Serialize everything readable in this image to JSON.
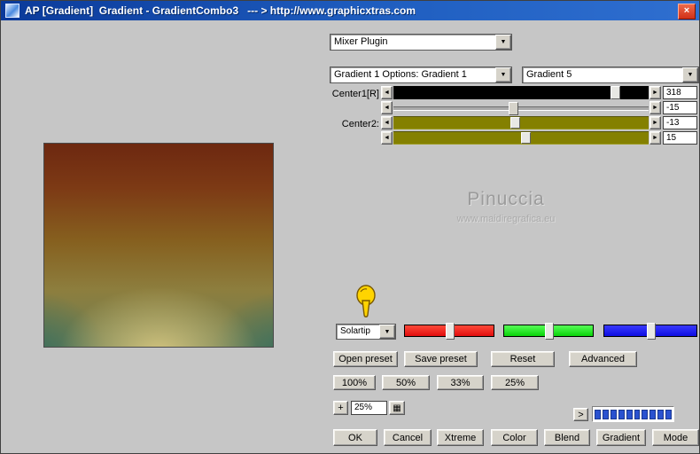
{
  "window": {
    "title": "AP [Gradient]  Gradient - GradientCombo3   --- > http://www.graphicxtras.com"
  },
  "icons": {
    "close": "×",
    "dropdown_arrow": "▼",
    "left_arrow": "◄",
    "right_arrow": "►",
    "grid": "▦"
  },
  "combos": {
    "plugin": "Mixer Plugin",
    "gradient_options": "Gradient 1 Options: Gradient 1",
    "gradient_preset": "Gradient 5",
    "tip": "Solartip",
    "zoom_value": "25%"
  },
  "sliders": {
    "center1_label": "Center1[R]",
    "center2_label": "Center2:",
    "values": [
      "318",
      "-15",
      "-13",
      "15"
    ]
  },
  "watermark": {
    "name": "Pinuccia",
    "url": "www.maidiregrafica.eu"
  },
  "buttons": {
    "preset_row": [
      "Open preset",
      "Save preset",
      "Reset",
      "Advanced"
    ],
    "zoom_row": [
      "100%",
      "50%",
      "33%",
      "25%"
    ],
    "plus": "+",
    "next": ">",
    "bottom_row": [
      "OK",
      "Cancel",
      "Xtreme",
      "Color",
      "Blend",
      "Gradient",
      "Mode"
    ]
  },
  "colors": {
    "title_bar": "#0b3a9a",
    "red_channel": "#e00d0d",
    "green_channel": "#0ad20a",
    "blue_channel": "#0d0de0",
    "olive_track": "#848000",
    "black_track": "#000000",
    "meter_segment": "#2a52d0"
  }
}
